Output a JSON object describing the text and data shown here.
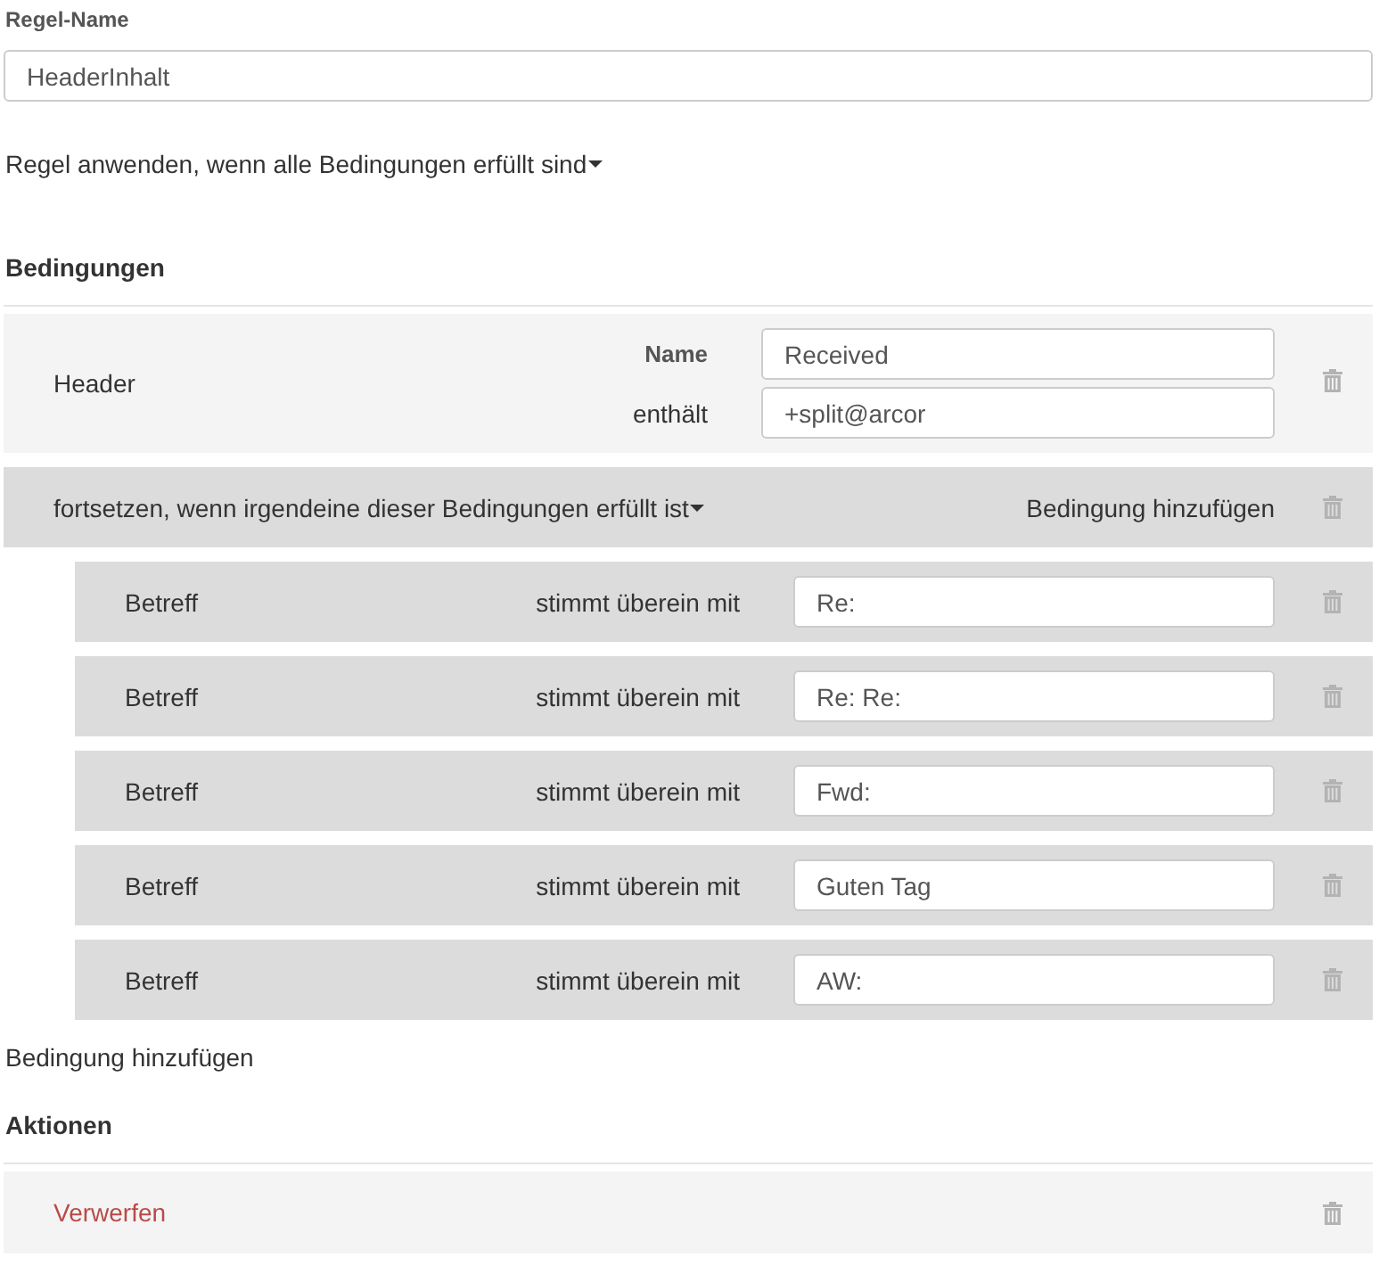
{
  "rule_name": {
    "label": "Regel-Name",
    "value": "HeaderInhalt"
  },
  "match_mode": {
    "label": "Regel anwenden, wenn alle Bedingungen erfüllt sind"
  },
  "conditions": {
    "heading": "Bedingungen",
    "items": [
      {
        "kind": "header",
        "label": "Header",
        "name_label": "Name",
        "name_value": "Received",
        "operator": "enthält",
        "value": "+split@arcor"
      },
      {
        "kind": "group",
        "label": "fortsetzen, wenn irgendeine dieser Bedingungen erfüllt ist",
        "add_label": "Bedingung hinzufügen",
        "children": [
          {
            "kind": "match",
            "field": "Betreff",
            "operator": "stimmt überein mit",
            "value": "Re:"
          },
          {
            "kind": "match",
            "field": "Betreff",
            "operator": "stimmt überein mit",
            "value": "Re: Re:"
          },
          {
            "kind": "match",
            "field": "Betreff",
            "operator": "stimmt überein mit",
            "value": "Fwd:"
          },
          {
            "kind": "match",
            "field": "Betreff",
            "operator": "stimmt überein mit",
            "value": "Guten Tag"
          },
          {
            "kind": "match",
            "field": "Betreff",
            "operator": "stimmt überein mit",
            "value": "AW:"
          }
        ]
      }
    ],
    "add_label": "Bedingung hinzufügen"
  },
  "actions": {
    "heading": "Aktionen",
    "items": [
      {
        "kind": "discard",
        "label": "Verwerfen"
      }
    ]
  }
}
